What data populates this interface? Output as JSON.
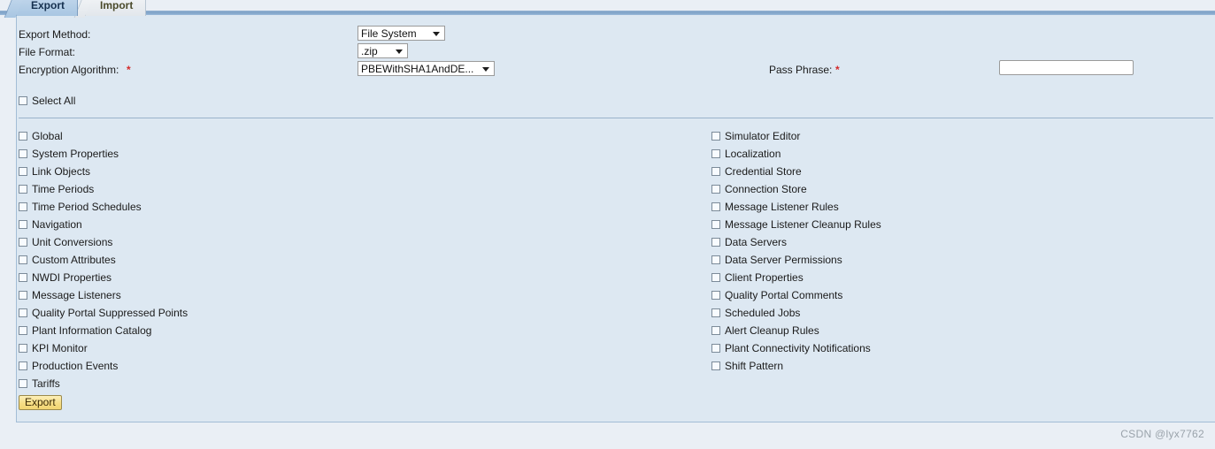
{
  "tabs": [
    {
      "label": "Export",
      "active": true
    },
    {
      "label": "Import",
      "active": false
    }
  ],
  "form": {
    "export_method": {
      "label": "Export Method:",
      "value": "File System",
      "options": [
        "File System"
      ]
    },
    "file_format": {
      "label": "File Format:",
      "value": ".zip",
      "options": [
        ".zip"
      ]
    },
    "encryption_algorithm": {
      "label": "Encryption Algorithm:",
      "required_marker": "*",
      "value": "PBEWithSHA1AndDE...",
      "options": [
        "PBEWithSHA1AndDE..."
      ]
    },
    "pass_phrase": {
      "label": "Pass Phrase:",
      "required_marker": "*",
      "value": "",
      "placeholder": ""
    }
  },
  "select_all": {
    "label": "Select All",
    "checked": false
  },
  "left_column": [
    {
      "label": "Global",
      "checked": false
    },
    {
      "label": "System Properties",
      "checked": false
    },
    {
      "label": "Link Objects",
      "checked": false
    },
    {
      "label": "Time Periods",
      "checked": false
    },
    {
      "label": "Time Period Schedules",
      "checked": false
    },
    {
      "label": "Navigation",
      "checked": false
    },
    {
      "label": "Unit Conversions",
      "checked": false
    },
    {
      "label": "Custom Attributes",
      "checked": false
    },
    {
      "label": "NWDI Properties",
      "checked": false
    },
    {
      "label": "Message Listeners",
      "checked": false
    },
    {
      "label": "Quality Portal Suppressed Points",
      "checked": false
    },
    {
      "label": "Plant Information Catalog",
      "checked": false
    },
    {
      "label": "KPI Monitor",
      "checked": false
    },
    {
      "label": "Production Events",
      "checked": false
    },
    {
      "label": "Tariffs",
      "checked": false
    }
  ],
  "right_column": [
    {
      "label": "Simulator Editor",
      "checked": false
    },
    {
      "label": "Localization",
      "checked": false
    },
    {
      "label": "Credential Store",
      "checked": false
    },
    {
      "label": "Connection Store",
      "checked": false
    },
    {
      "label": "Message Listener Rules",
      "checked": false
    },
    {
      "label": "Message Listener Cleanup Rules",
      "checked": false
    },
    {
      "label": "Data Servers",
      "checked": false
    },
    {
      "label": "Data Server Permissions",
      "checked": false
    },
    {
      "label": "Client Properties",
      "checked": false
    },
    {
      "label": "Quality Portal Comments",
      "checked": false
    },
    {
      "label": "Scheduled Jobs",
      "checked": false
    },
    {
      "label": "Alert Cleanup Rules",
      "checked": false
    },
    {
      "label": "Plant Connectivity Notifications",
      "checked": false
    },
    {
      "label": "Shift Pattern",
      "checked": false
    }
  ],
  "actions": {
    "export_button": "Export"
  },
  "watermark": "CSDN @lyx7762",
  "colors": {
    "panel_bg": "#dde8f2",
    "page_bg": "#eaeff5",
    "tab_active": "#a8c6e2",
    "required_marker": "#d42a2a",
    "button_bg": "#f6dd85",
    "divider": "#9ab3cb"
  }
}
